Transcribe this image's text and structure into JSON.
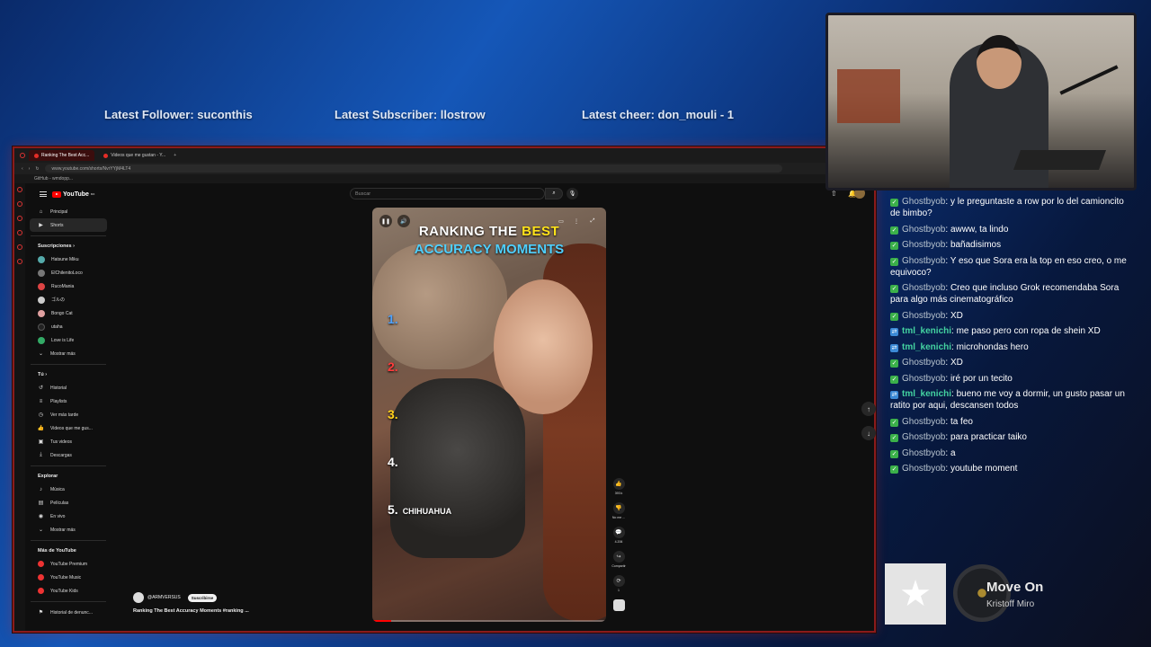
{
  "stream_overlay": {
    "latest_follower": "Latest Follower: suconthis",
    "latest_subscriber": "Latest Subscriber: llostrow",
    "latest_cheer": "Latest cheer: don_mouli - 1"
  },
  "browser": {
    "tabs": [
      {
        "label": "Ranking The Best Acc..."
      },
      {
        "label": "Videos que me gustan - Y..."
      }
    ],
    "url": "www.youtube.com/shorts/NvrYYjM4LT4",
    "bookmark": "GitHub - wmdopp..."
  },
  "youtube": {
    "logo": "YouTube",
    "logo_region": "MX",
    "search_placeholder": "Buscar",
    "sidebar_main": [
      {
        "label": "Principal",
        "icon": "home-icon"
      },
      {
        "label": "Shorts",
        "icon": "shorts-icon"
      }
    ],
    "subscriptions_heading": "Suscripciones",
    "subscriptions": [
      {
        "label": "Hatsune Miku",
        "color": "#5aa"
      },
      {
        "label": "ElChilenitoLoco",
        "color": "#777"
      },
      {
        "label": "RucoMania",
        "color": "#d44"
      },
      {
        "label": "ゴルの",
        "color": "#ccc"
      },
      {
        "label": "Bongo Cat",
        "color": "#e0a0a0"
      },
      {
        "label": "utaha",
        "color": "#222"
      },
      {
        "label": "Love is Life",
        "color": "#3a6"
      },
      {
        "label": "Mostrar más",
        "color": ""
      }
    ],
    "you_heading": "Tú",
    "you_items": [
      {
        "label": "Historial"
      },
      {
        "label": "Playlists"
      },
      {
        "label": "Ver más tarde"
      },
      {
        "label": "Videos que me gus..."
      },
      {
        "label": "Tus videos"
      },
      {
        "label": "Descargas"
      }
    ],
    "explore_heading": "Explorar",
    "explore_items": [
      {
        "label": "Música"
      },
      {
        "label": "Películas"
      },
      {
        "label": "En vivo"
      },
      {
        "label": "Mostrar más"
      }
    ],
    "more_heading": "Más de YouTube",
    "more_items": [
      {
        "label": "YouTube Premium"
      },
      {
        "label": "YouTube Music"
      },
      {
        "label": "YouTube Kids"
      }
    ],
    "report_item": "Historial de denunc...",
    "short": {
      "title_line1_a": "RANKING THE",
      "title_line1_b": "BEST",
      "title_line2": "ACCURACY MOMENTS",
      "ranks": [
        {
          "num": "1.",
          "text": "",
          "color": "#4fa3ff"
        },
        {
          "num": "2.",
          "text": "",
          "color": "#ff3b3b"
        },
        {
          "num": "3.",
          "text": "",
          "color": "#ffd21a"
        },
        {
          "num": "4.",
          "text": "",
          "color": "#ffffff"
        },
        {
          "num": "5.",
          "text": "CHIHUAHUA",
          "color": "#ffffff"
        }
      ],
      "likes": "393 k",
      "dislike_label": "No me ...",
      "comments": "4.206",
      "share_label": "Compartir",
      "remix_count": "1",
      "channel": "@ARMVERSUS",
      "subscribe_label": "Suscribirse",
      "video_title": "Ranking The Best Accuracy Moments #ranking ..."
    }
  },
  "chat": [
    {
      "user": "Ghostbyob",
      "badge": "green",
      "text": "y le preguntaste a row por lo del camioncito de bimbo?"
    },
    {
      "user": "Ghostbyob",
      "badge": "green",
      "text": "awww, ta lindo"
    },
    {
      "user": "Ghostbyob",
      "badge": "green",
      "text": "bañadisimos"
    },
    {
      "user": "Ghostbyob",
      "badge": "green",
      "text": "Y eso que Sora era la top en eso creo, o me equivoco?"
    },
    {
      "user": "Ghostbyob",
      "badge": "green",
      "text": "Creo que incluso Grok recomendaba Sora para algo más cinematográfico"
    },
    {
      "user": "Ghostbyob",
      "badge": "green",
      "text": "XD"
    },
    {
      "user": "tml_kenichi",
      "badge": "blue",
      "text": "me paso pero con ropa de shein XD"
    },
    {
      "user": "tml_kenichi",
      "badge": "blue",
      "text": "microhondas hero"
    },
    {
      "user": "Ghostbyob",
      "badge": "green",
      "text": "XD"
    },
    {
      "user": "Ghostbyob",
      "badge": "green",
      "text": "iré por un tecito"
    },
    {
      "user": "tml_kenichi",
      "badge": "blue",
      "text": "bueno me voy a dormir, un gusto pasar un ratito por aqui, descansen todos"
    },
    {
      "user": "Ghostbyob",
      "badge": "green",
      "text": "ta feo"
    },
    {
      "user": "Ghostbyob",
      "badge": "green",
      "text": "para practicar taiko"
    },
    {
      "user": "Ghostbyob",
      "badge": "green",
      "text": "a"
    },
    {
      "user": "Ghostbyob",
      "badge": "green",
      "text": "youtube moment"
    }
  ],
  "now_playing": {
    "title": "Move On",
    "artist": "Kristoff Miro"
  }
}
